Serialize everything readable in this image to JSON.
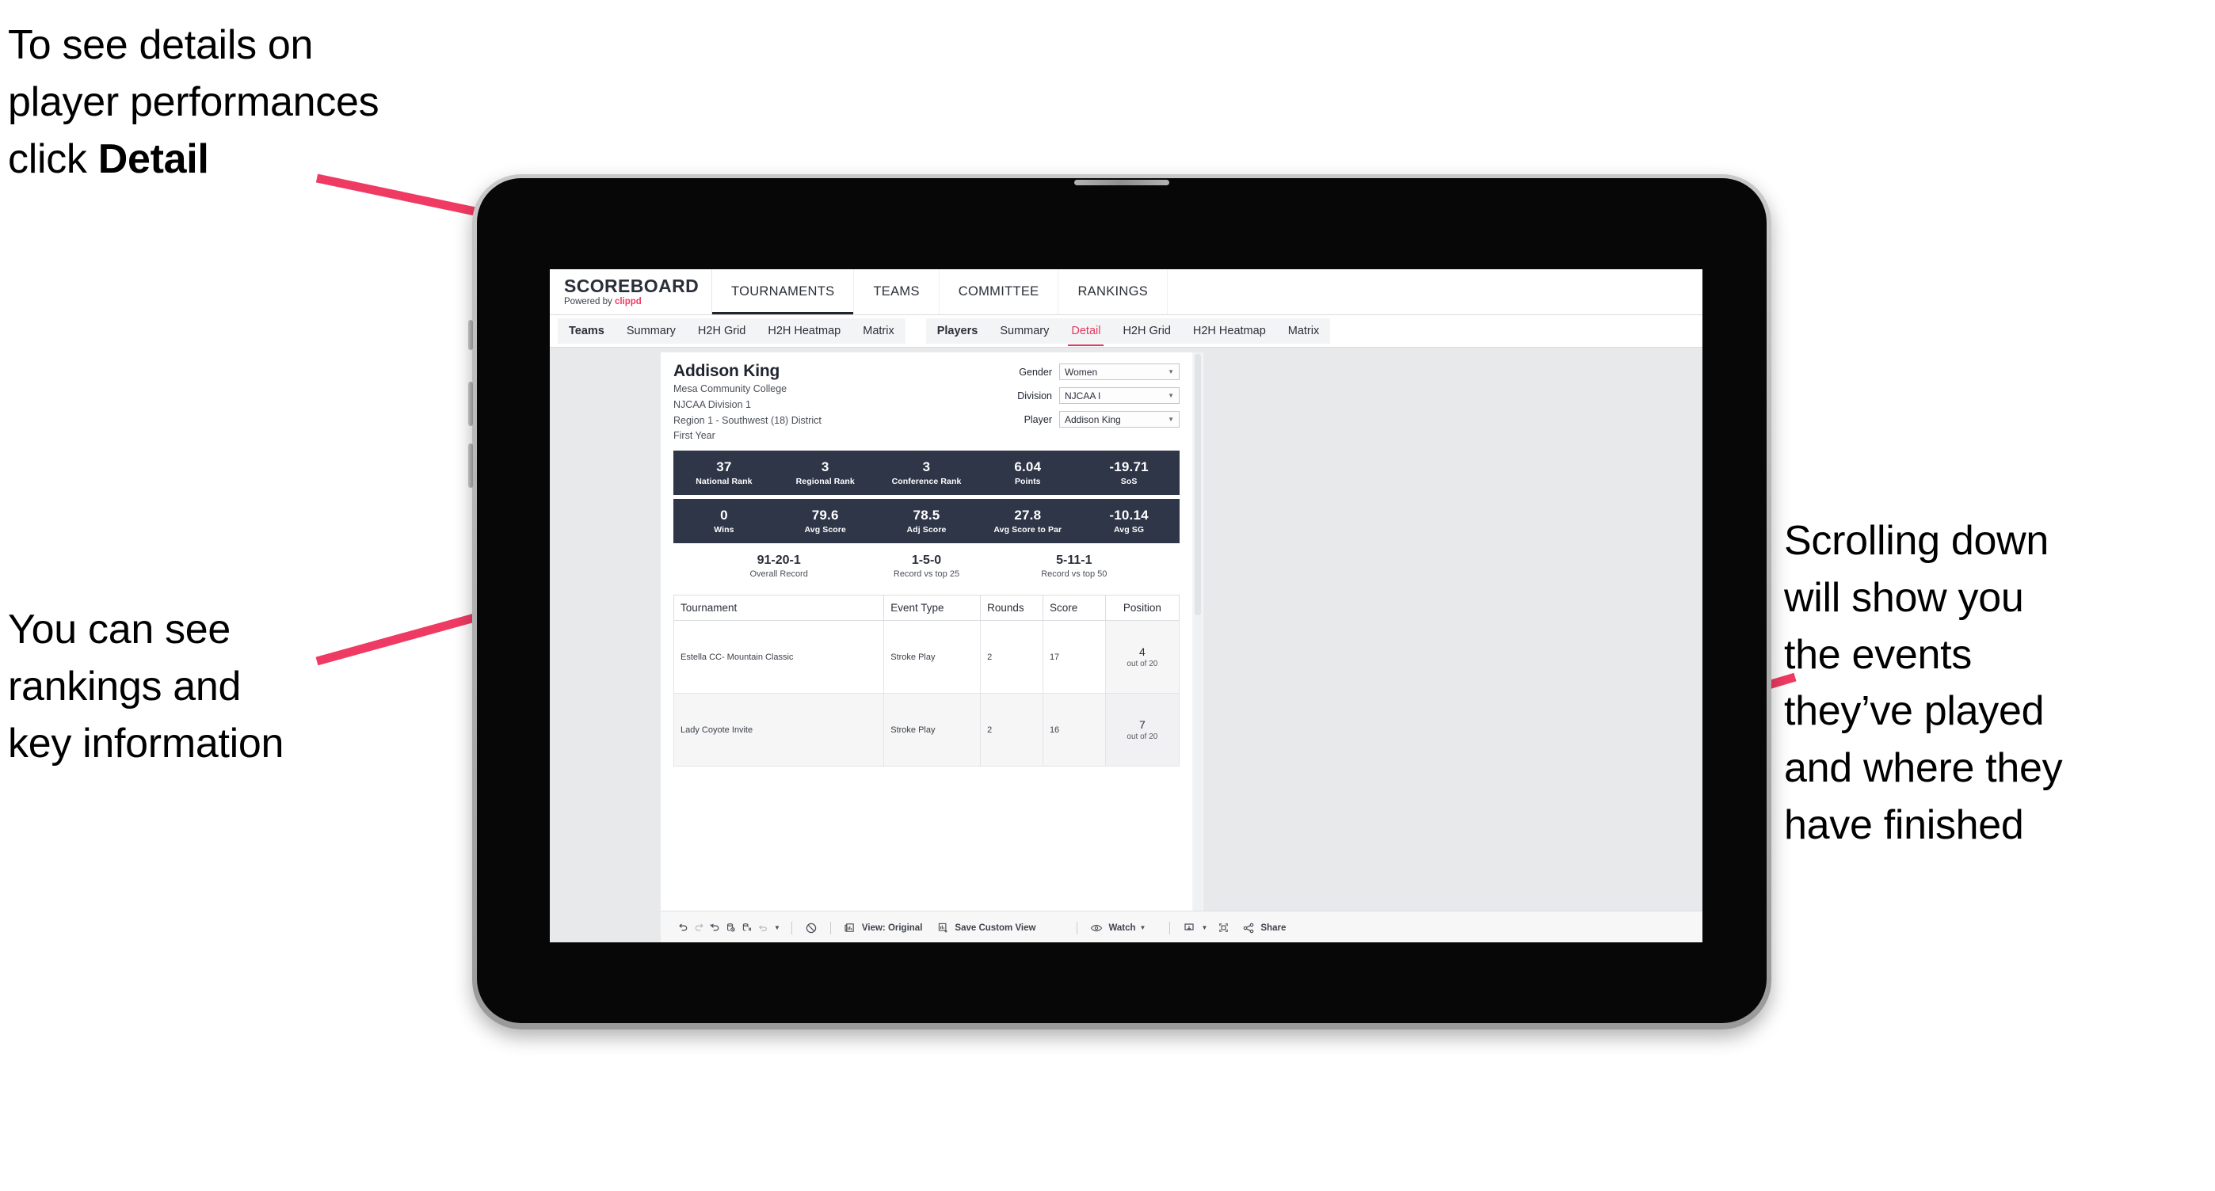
{
  "annotations": {
    "detail": "To see details on\nplayer performances\nclick ",
    "detail_bold": "Detail",
    "rankings": "You can see\nrankings and\nkey information",
    "scrolling": "Scrolling down\nwill show you\nthe events\nthey’ve played\nand where they\nhave finished"
  },
  "colors": {
    "accent_pink": "#ef3b63",
    "statbar_navy": "#2f3648",
    "tab_active": "#e03a5f"
  },
  "app": {
    "brand": {
      "title": "SCOREBOARD",
      "powered_prefix": "Powered by ",
      "powered_name": "clippd"
    },
    "top_nav": [
      {
        "label": "TOURNAMENTS",
        "active": true
      },
      {
        "label": "TEAMS",
        "active": false
      },
      {
        "label": "COMMITTEE",
        "active": false
      },
      {
        "label": "RANKINGS",
        "active": false
      }
    ],
    "sub_nav_teams": [
      {
        "label": "Teams"
      },
      {
        "label": "Summary"
      },
      {
        "label": "H2H Grid"
      },
      {
        "label": "H2H Heatmap"
      },
      {
        "label": "Matrix"
      }
    ],
    "sub_nav_players": [
      {
        "label": "Players"
      },
      {
        "label": "Summary"
      },
      {
        "label": "Detail"
      },
      {
        "label": "H2H Grid"
      },
      {
        "label": "H2H Heatmap"
      },
      {
        "label": "Matrix"
      }
    ]
  },
  "player": {
    "name": "Addison King",
    "school": "Mesa Community College",
    "division": "NJCAA Division 1",
    "region": "Region 1 - Southwest (18) District",
    "year": "First Year"
  },
  "filters": [
    {
      "label": "Gender",
      "value": "Women"
    },
    {
      "label": "Division",
      "value": "NJCAA I"
    },
    {
      "label": "Player",
      "value": "Addison King"
    }
  ],
  "stats_row1": [
    {
      "value": "37",
      "label": "National Rank"
    },
    {
      "value": "3",
      "label": "Regional Rank"
    },
    {
      "value": "3",
      "label": "Conference Rank"
    },
    {
      "value": "6.04",
      "label": "Points"
    },
    {
      "value": "-19.71",
      "label": "SoS"
    }
  ],
  "stats_row2": [
    {
      "value": "0",
      "label": "Wins"
    },
    {
      "value": "79.6",
      "label": "Avg Score"
    },
    {
      "value": "78.5",
      "label": "Adj Score"
    },
    {
      "value": "27.8",
      "label": "Avg Score to Par"
    },
    {
      "value": "-10.14",
      "label": "Avg SG"
    }
  ],
  "records": [
    {
      "value": "91-20-1",
      "label": "Overall Record"
    },
    {
      "value": "1-5-0",
      "label": "Record vs top 25"
    },
    {
      "value": "5-11-1",
      "label": "Record vs top 50"
    }
  ],
  "results_table": {
    "columns": [
      "Tournament",
      "Event Type",
      "Rounds",
      "Score",
      "Position"
    ],
    "rows": [
      {
        "tournament": "Estella CC- Mountain Classic",
        "event_type": "Stroke Play",
        "rounds": "2",
        "score": "17",
        "position": "4",
        "position_of": "out of 20"
      },
      {
        "tournament": "Lady Coyote Invite",
        "event_type": "Stroke Play",
        "rounds": "2",
        "score": "16",
        "position": "7",
        "position_of": "out of 20"
      }
    ]
  },
  "toolbar": {
    "view_label": "View: Original",
    "save_label": "Save Custom View",
    "watch_label": "Watch",
    "share_label": "Share"
  }
}
